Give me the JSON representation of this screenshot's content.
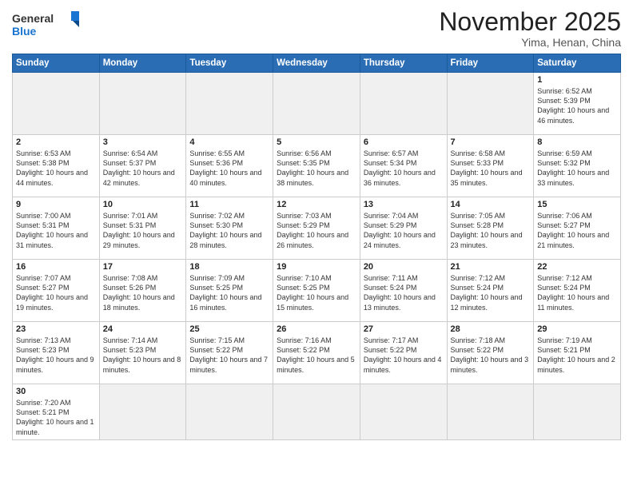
{
  "header": {
    "logo_general": "General",
    "logo_blue": "Blue",
    "title": "November 2025",
    "subtitle": "Yima, Henan, China"
  },
  "days_of_week": [
    "Sunday",
    "Monday",
    "Tuesday",
    "Wednesday",
    "Thursday",
    "Friday",
    "Saturday"
  ],
  "weeks": [
    [
      {
        "day": "",
        "info": "",
        "empty": true
      },
      {
        "day": "",
        "info": "",
        "empty": true
      },
      {
        "day": "",
        "info": "",
        "empty": true
      },
      {
        "day": "",
        "info": "",
        "empty": true
      },
      {
        "day": "",
        "info": "",
        "empty": true
      },
      {
        "day": "",
        "info": "",
        "empty": true
      },
      {
        "day": "1",
        "info": "Sunrise: 6:52 AM\nSunset: 5:39 PM\nDaylight: 10 hours\nand 46 minutes."
      }
    ],
    [
      {
        "day": "2",
        "info": "Sunrise: 6:53 AM\nSunset: 5:38 PM\nDaylight: 10 hours\nand 44 minutes."
      },
      {
        "day": "3",
        "info": "Sunrise: 6:54 AM\nSunset: 5:37 PM\nDaylight: 10 hours\nand 42 minutes."
      },
      {
        "day": "4",
        "info": "Sunrise: 6:55 AM\nSunset: 5:36 PM\nDaylight: 10 hours\nand 40 minutes."
      },
      {
        "day": "5",
        "info": "Sunrise: 6:56 AM\nSunset: 5:35 PM\nDaylight: 10 hours\nand 38 minutes."
      },
      {
        "day": "6",
        "info": "Sunrise: 6:57 AM\nSunset: 5:34 PM\nDaylight: 10 hours\nand 36 minutes."
      },
      {
        "day": "7",
        "info": "Sunrise: 6:58 AM\nSunset: 5:33 PM\nDaylight: 10 hours\nand 35 minutes."
      },
      {
        "day": "8",
        "info": "Sunrise: 6:59 AM\nSunset: 5:32 PM\nDaylight: 10 hours\nand 33 minutes."
      }
    ],
    [
      {
        "day": "9",
        "info": "Sunrise: 7:00 AM\nSunset: 5:31 PM\nDaylight: 10 hours\nand 31 minutes."
      },
      {
        "day": "10",
        "info": "Sunrise: 7:01 AM\nSunset: 5:31 PM\nDaylight: 10 hours\nand 29 minutes."
      },
      {
        "day": "11",
        "info": "Sunrise: 7:02 AM\nSunset: 5:30 PM\nDaylight: 10 hours\nand 28 minutes."
      },
      {
        "day": "12",
        "info": "Sunrise: 7:03 AM\nSunset: 5:29 PM\nDaylight: 10 hours\nand 26 minutes."
      },
      {
        "day": "13",
        "info": "Sunrise: 7:04 AM\nSunset: 5:29 PM\nDaylight: 10 hours\nand 24 minutes."
      },
      {
        "day": "14",
        "info": "Sunrise: 7:05 AM\nSunset: 5:28 PM\nDaylight: 10 hours\nand 23 minutes."
      },
      {
        "day": "15",
        "info": "Sunrise: 7:06 AM\nSunset: 5:27 PM\nDaylight: 10 hours\nand 21 minutes."
      }
    ],
    [
      {
        "day": "16",
        "info": "Sunrise: 7:07 AM\nSunset: 5:27 PM\nDaylight: 10 hours\nand 19 minutes."
      },
      {
        "day": "17",
        "info": "Sunrise: 7:08 AM\nSunset: 5:26 PM\nDaylight: 10 hours\nand 18 minutes."
      },
      {
        "day": "18",
        "info": "Sunrise: 7:09 AM\nSunset: 5:25 PM\nDaylight: 10 hours\nand 16 minutes."
      },
      {
        "day": "19",
        "info": "Sunrise: 7:10 AM\nSunset: 5:25 PM\nDaylight: 10 hours\nand 15 minutes."
      },
      {
        "day": "20",
        "info": "Sunrise: 7:11 AM\nSunset: 5:24 PM\nDaylight: 10 hours\nand 13 minutes."
      },
      {
        "day": "21",
        "info": "Sunrise: 7:12 AM\nSunset: 5:24 PM\nDaylight: 10 hours\nand 12 minutes."
      },
      {
        "day": "22",
        "info": "Sunrise: 7:12 AM\nSunset: 5:24 PM\nDaylight: 10 hours\nand 11 minutes."
      }
    ],
    [
      {
        "day": "23",
        "info": "Sunrise: 7:13 AM\nSunset: 5:23 PM\nDaylight: 10 hours\nand 9 minutes."
      },
      {
        "day": "24",
        "info": "Sunrise: 7:14 AM\nSunset: 5:23 PM\nDaylight: 10 hours\nand 8 minutes."
      },
      {
        "day": "25",
        "info": "Sunrise: 7:15 AM\nSunset: 5:22 PM\nDaylight: 10 hours\nand 7 minutes."
      },
      {
        "day": "26",
        "info": "Sunrise: 7:16 AM\nSunset: 5:22 PM\nDaylight: 10 hours\nand 5 minutes."
      },
      {
        "day": "27",
        "info": "Sunrise: 7:17 AM\nSunset: 5:22 PM\nDaylight: 10 hours\nand 4 minutes."
      },
      {
        "day": "28",
        "info": "Sunrise: 7:18 AM\nSunset: 5:22 PM\nDaylight: 10 hours\nand 3 minutes."
      },
      {
        "day": "29",
        "info": "Sunrise: 7:19 AM\nSunset: 5:21 PM\nDaylight: 10 hours\nand 2 minutes."
      }
    ],
    [
      {
        "day": "30",
        "info": "Sunrise: 7:20 AM\nSunset: 5:21 PM\nDaylight: 10 hours\nand 1 minute.",
        "last": true
      },
      {
        "day": "",
        "info": "",
        "empty": true,
        "last": true
      },
      {
        "day": "",
        "info": "",
        "empty": true,
        "last": true
      },
      {
        "day": "",
        "info": "",
        "empty": true,
        "last": true
      },
      {
        "day": "",
        "info": "",
        "empty": true,
        "last": true
      },
      {
        "day": "",
        "info": "",
        "empty": true,
        "last": true
      },
      {
        "day": "",
        "info": "",
        "empty": true,
        "last": true
      }
    ]
  ]
}
